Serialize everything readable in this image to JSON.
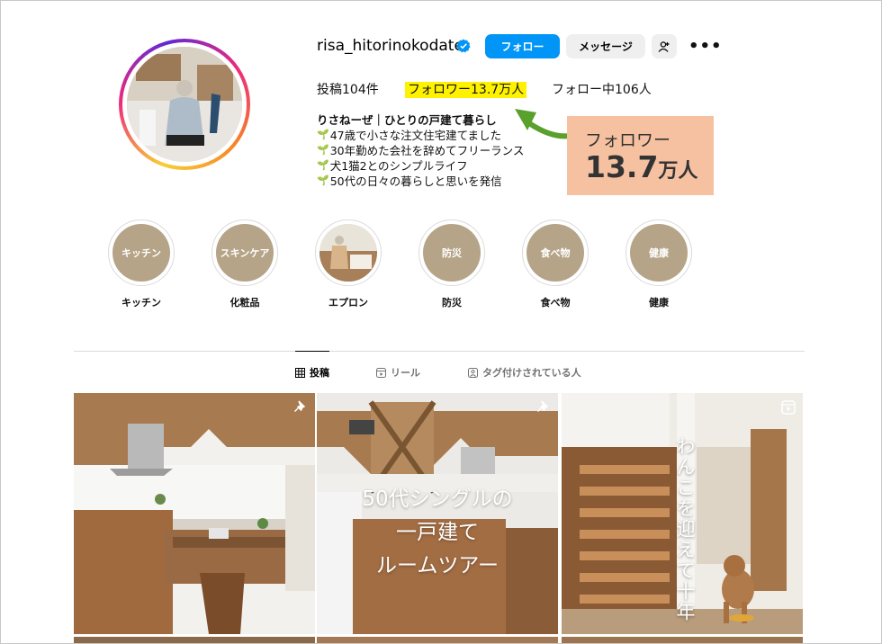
{
  "profile": {
    "username": "risa_hitorinokodate",
    "follow_label": "フォロー",
    "message_label": "メッセージ",
    "more_label": "•••",
    "stats": {
      "posts": "投稿104件",
      "followers": "フォロワー13.7万人",
      "following": "フォロー中106人"
    },
    "bio": {
      "name": "りさねーぜ｜ひとりの戸建て暮らし",
      "lines": [
        "47歳で小さな注文住宅建てました",
        "30年勤めた会社を辞めてフリーランス",
        "犬1猫2とのシンプルライフ",
        "50代の日々の暮らしと思いを発信"
      ]
    }
  },
  "callout": {
    "label": "フォロワー",
    "number": "13.7",
    "unit": "万人"
  },
  "highlights": [
    {
      "cover_text": "キッチン",
      "label": "キッチン"
    },
    {
      "cover_text": "スキンケア",
      "label": "化粧品"
    },
    {
      "cover_text": "",
      "label": "エプロン"
    },
    {
      "cover_text": "防災",
      "label": "防災"
    },
    {
      "cover_text": "食べ物",
      "label": "食べ物"
    },
    {
      "cover_text": "健康",
      "label": "健康"
    }
  ],
  "tabs": [
    {
      "label": "投稿"
    },
    {
      "label": "リール"
    },
    {
      "label": "タグ付けされている人"
    }
  ],
  "posts": [
    {
      "overlay": ""
    },
    {
      "overlay_line1": "50代シングルの",
      "overlay_line2": "一戸建て",
      "overlay_line3": "ルームツアー"
    },
    {
      "overlay_vertical": "わんこを迎えて十年"
    }
  ],
  "colors": {
    "follow_button": "#0095f6",
    "highlight_cover": "#b5a487",
    "stat_highlight": "#fff200",
    "callout_bg": "#f5c1a0",
    "arrow": "#5aa02c"
  }
}
